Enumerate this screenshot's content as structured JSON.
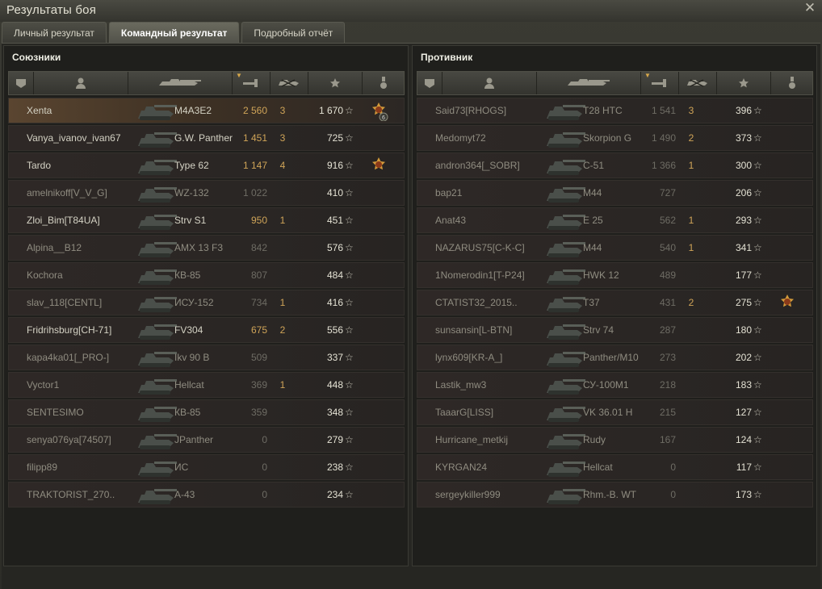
{
  "window": {
    "title": "Результаты боя"
  },
  "tabs": [
    {
      "label": "Личный результат"
    },
    {
      "label": "Командный результат"
    },
    {
      "label": "Подробный отчёт"
    }
  ],
  "allies": {
    "title": "Союзники",
    "rows": [
      {
        "name": "Xenta",
        "vehicle": "M4A3E2",
        "damage": "2 560",
        "kills": "3",
        "xp": "1 670",
        "medal": "medal-with-6",
        "highlight": true
      },
      {
        "name": "Vanya_ivanov_ivan67",
        "vehicle": "G.W. Panther",
        "damage": "1 451",
        "kills": "3",
        "xp": "725"
      },
      {
        "name": "Tardo",
        "vehicle": "Type 62",
        "damage": "1 147",
        "kills": "4",
        "xp": "916",
        "medal": "order-medal"
      },
      {
        "name": "amelnikoff[V_V_G]",
        "vehicle": "WZ-132",
        "damage": "1 022",
        "kills": "",
        "xp": "410",
        "dim": true
      },
      {
        "name": "Zloi_Bim[T84UA]",
        "vehicle": "Strv S1",
        "damage": "950",
        "kills": "1",
        "xp": "451"
      },
      {
        "name": "Alpina__B12",
        "vehicle": "AMX 13 F3",
        "damage": "842",
        "kills": "",
        "xp": "576",
        "dim": true
      },
      {
        "name": "Kochora",
        "vehicle": "КВ-85",
        "damage": "807",
        "kills": "",
        "xp": "484",
        "dim": true
      },
      {
        "name": "slav_118[CENTL]",
        "vehicle": "ИСУ-152",
        "damage": "734",
        "kills": "1",
        "xp": "416",
        "dim": true
      },
      {
        "name": "Fridrihsburg[CH-71]",
        "vehicle": "FV304",
        "damage": "675",
        "kills": "2",
        "xp": "556"
      },
      {
        "name": "kapa4ka01[_PRO-]",
        "vehicle": "Ikv 90 B",
        "damage": "509",
        "kills": "",
        "xp": "337",
        "dim": true
      },
      {
        "name": "Vyctor1",
        "vehicle": "Hellcat",
        "damage": "369",
        "kills": "1",
        "xp": "448",
        "dim": true
      },
      {
        "name": "SENTESIMO",
        "vehicle": "КВ-85",
        "damage": "359",
        "kills": "",
        "xp": "348",
        "dim": true
      },
      {
        "name": "senya076ya[74507]",
        "vehicle": "JPanther",
        "damage": "0",
        "kills": "",
        "xp": "279",
        "dim": true
      },
      {
        "name": "filipp89",
        "vehicle": "ИС",
        "damage": "0",
        "kills": "",
        "xp": "238",
        "dim": true
      },
      {
        "name": "TRAKTORIST_270..",
        "vehicle": "А-43",
        "damage": "0",
        "kills": "",
        "xp": "234",
        "dim": true
      }
    ]
  },
  "enemies": {
    "title": "Противник",
    "rows": [
      {
        "name": "Said73[RHOGS]",
        "vehicle": "T28 HTC",
        "damage": "1 541",
        "kills": "3",
        "xp": "396",
        "dim": true
      },
      {
        "name": "Medomyt72",
        "vehicle": "Skorpion G",
        "damage": "1 490",
        "kills": "2",
        "xp": "373",
        "dim": true
      },
      {
        "name": "andron364[_SOBR]",
        "vehicle": "С-51",
        "damage": "1 366",
        "kills": "1",
        "xp": "300",
        "dim": true
      },
      {
        "name": "bap21",
        "vehicle": "M44",
        "damage": "727",
        "kills": "",
        "xp": "206",
        "dim": true
      },
      {
        "name": "Anat43",
        "vehicle": "E 25",
        "damage": "562",
        "kills": "1",
        "xp": "293",
        "dim": true
      },
      {
        "name": "NAZARUS75[C-K-C]",
        "vehicle": "M44",
        "damage": "540",
        "kills": "1",
        "xp": "341",
        "dim": true
      },
      {
        "name": "1Nomerodin1[T-P24]",
        "vehicle": "HWK 12",
        "damage": "489",
        "kills": "",
        "xp": "177",
        "dim": true
      },
      {
        "name": "CTATIST32_2015..",
        "vehicle": "T37",
        "damage": "431",
        "kills": "2",
        "xp": "275",
        "dim": true,
        "medal": "order-medal"
      },
      {
        "name": "sunsansin[L-BTN]",
        "vehicle": "Strv 74",
        "damage": "287",
        "kills": "",
        "xp": "180",
        "dim": true
      },
      {
        "name": "lynx609[KR-A_]",
        "vehicle": "Panther/M10",
        "damage": "273",
        "kills": "",
        "xp": "202",
        "dim": true
      },
      {
        "name": "Lastik_mw3",
        "vehicle": "СУ-100М1",
        "damage": "218",
        "kills": "",
        "xp": "183",
        "dim": true
      },
      {
        "name": "TaaarG[LISS]",
        "vehicle": "VK 36.01 H",
        "damage": "215",
        "kills": "",
        "xp": "127",
        "dim": true
      },
      {
        "name": "Hurricane_metkij",
        "vehicle": "Rudy",
        "damage": "167",
        "kills": "",
        "xp": "124",
        "dim": true
      },
      {
        "name": "KYRGAN24",
        "vehicle": "Hellcat",
        "damage": "0",
        "kills": "",
        "xp": "117",
        "dim": true
      },
      {
        "name": "sergeykiller999",
        "vehicle": "Rhm.-B. WT",
        "damage": "0",
        "kills": "",
        "xp": "173",
        "dim": true
      }
    ]
  },
  "icons": {
    "close": "close-icon",
    "columns": [
      "squad-icon",
      "player-icon",
      "vehicle-icon",
      "damage-icon",
      "kills-icon",
      "xp-star-icon",
      "medal-icon"
    ],
    "star_glyph": "☆"
  },
  "medal_count": "6",
  "colors": {
    "accent": "#cfa458",
    "highlight_row": "#5a4530"
  }
}
